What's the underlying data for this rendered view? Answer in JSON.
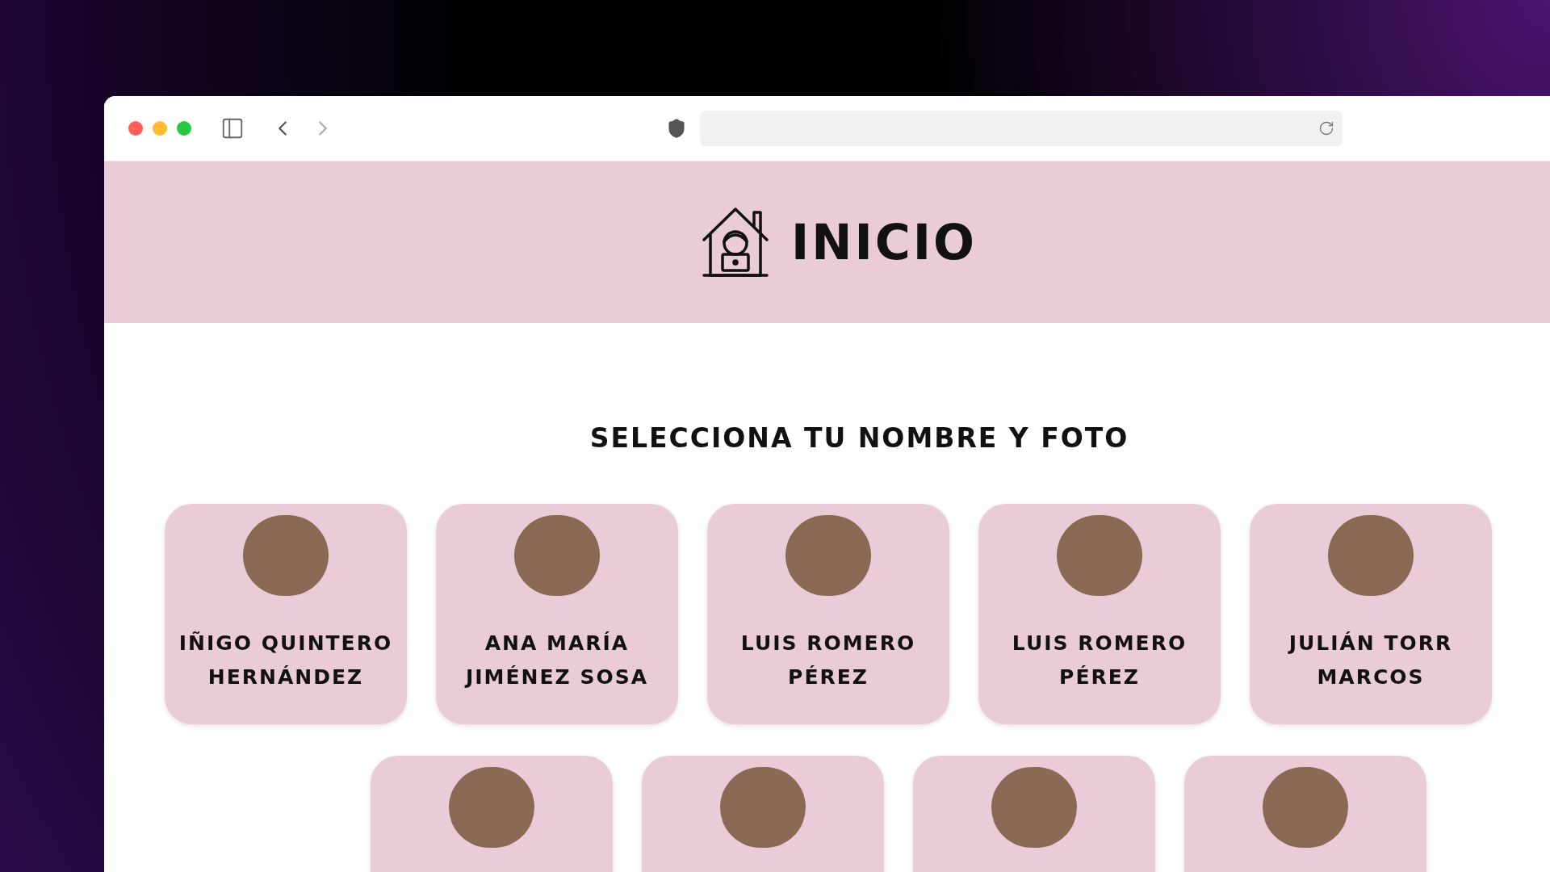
{
  "header": {
    "title": "INICIO"
  },
  "heading": "SELECCIONA TU NOMBRE Y FOTO",
  "rows": [
    [
      {
        "kind": "named",
        "name_lines": [
          "IÑIGO QUINTERO",
          "HERNÁNDEZ"
        ]
      },
      {
        "kind": "named",
        "name_lines": [
          "ANA MARÍA",
          "JIMÉNEZ SOSA"
        ]
      },
      {
        "kind": "named",
        "name_lines": [
          "LUIS ROMERO",
          "PÉREZ"
        ]
      },
      {
        "kind": "named",
        "name_lines": [
          "LUIS ROMERO",
          "PÉREZ"
        ]
      },
      {
        "kind": "named",
        "name_lines": [
          "JULIÁN TORR",
          "MARCOS"
        ]
      }
    ],
    [
      {
        "kind": "photo"
      },
      {
        "kind": "photo"
      },
      {
        "kind": "photo"
      },
      {
        "kind": "photo"
      }
    ]
  ]
}
